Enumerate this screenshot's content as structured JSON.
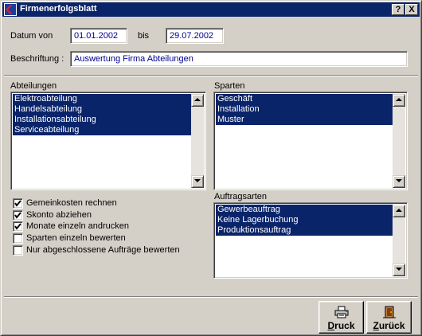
{
  "window": {
    "title": "Firmenerfolgsblatt",
    "help_button": "?",
    "close_button": "X",
    "accent_color": "#0a246a"
  },
  "form": {
    "datum_von_label": "Datum von",
    "datum_von_value": "01.01.2002",
    "bis_label": "bis",
    "bis_value": "29.07.2002",
    "beschriftung_label": "Beschriftung :",
    "beschriftung_value": "Auswertung Firma Abteilungen"
  },
  "abteilungen": {
    "label": "Abteilungen",
    "items": [
      "Elektroabteilung",
      "Handelsabteilung",
      "Installationsabteilung",
      "Serviceabteilung"
    ]
  },
  "sparten": {
    "label": "Sparten",
    "items": [
      "Geschäft",
      "Installation",
      "Muster"
    ]
  },
  "auftragsarten": {
    "label": "Auftragsarten",
    "items": [
      "Gewerbeauftrag",
      "Keine Lagerbuchung",
      "Produktionsauftrag"
    ]
  },
  "options": [
    {
      "label": "Gemeinkosten rechnen",
      "checked": true
    },
    {
      "label": "Skonto abziehen",
      "checked": true
    },
    {
      "label": "Monate einzeln andrucken",
      "checked": true
    },
    {
      "label": "Sparten einzeln bewerten",
      "checked": false
    },
    {
      "label": "Nur abgeschlossene Aufträge bewerten",
      "checked": false
    }
  ],
  "buttons": {
    "druck_first": "D",
    "druck_rest": "ruck",
    "druck_icon": "printer-icon",
    "zurueck_first": "Z",
    "zurueck_rest": "urück",
    "zurueck_icon": "door-exit-icon"
  }
}
